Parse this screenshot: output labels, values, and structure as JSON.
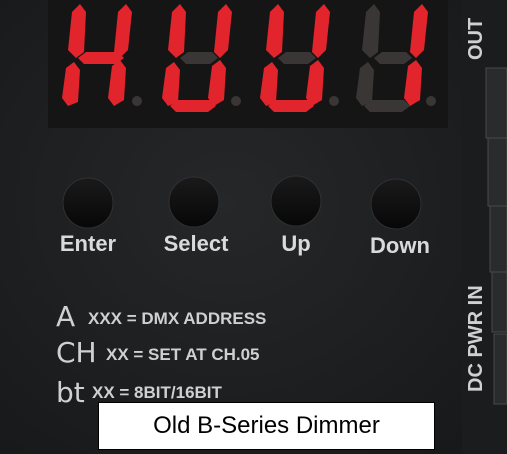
{
  "display": {
    "digits": [
      "H",
      "U",
      "U",
      "1"
    ],
    "color": "#e2242d"
  },
  "buttons": [
    {
      "label": "Enter"
    },
    {
      "label": "Select"
    },
    {
      "label": "Up"
    },
    {
      "label": "Down"
    }
  ],
  "legend": [
    {
      "code": "A",
      "text": "XXX = DMX ADDRESS"
    },
    {
      "code": "CH",
      "text": "XX = SET AT CH.05"
    },
    {
      "code": "bt",
      "text": "XX = 8BIT/16BIT"
    }
  ],
  "side_labels": {
    "top": "OUT",
    "bottom": "DC PWR IN"
  },
  "caption": "Old B-Series Dimmer",
  "colors": {
    "panel": "#202223",
    "display_window": "#151515",
    "segment_on": "#e2242d",
    "label_text": "#d9dadc"
  }
}
